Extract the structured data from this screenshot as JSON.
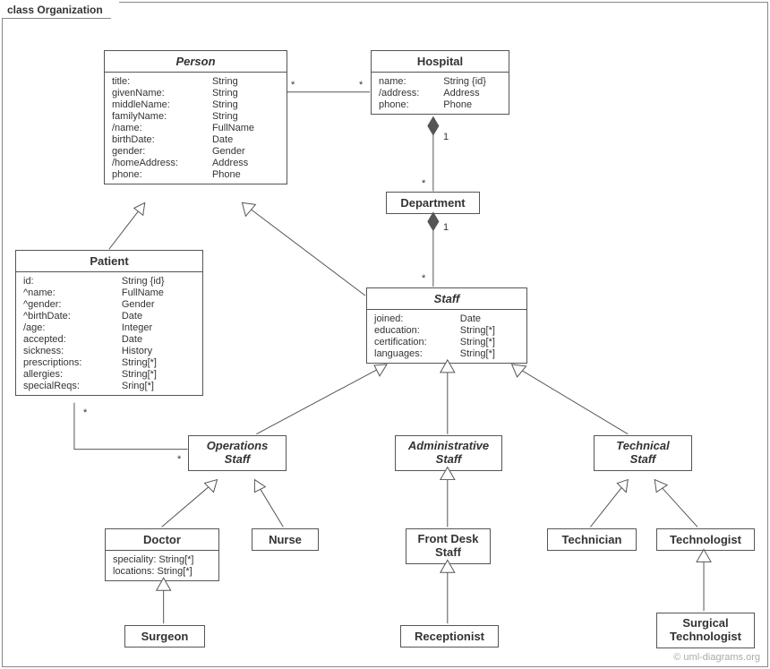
{
  "frame": {
    "title": "class Organization"
  },
  "watermark": "© uml-diagrams.org",
  "classes": {
    "person": {
      "name": "Person",
      "attrs": [
        {
          "n": "title:",
          "t": "String"
        },
        {
          "n": "givenName:",
          "t": "String"
        },
        {
          "n": "middleName:",
          "t": "String"
        },
        {
          "n": "familyName:",
          "t": "String"
        },
        {
          "n": "/name:",
          "t": "FullName"
        },
        {
          "n": "birthDate:",
          "t": "Date"
        },
        {
          "n": "gender:",
          "t": "Gender"
        },
        {
          "n": "/homeAddress:",
          "t": "Address"
        },
        {
          "n": "phone:",
          "t": "Phone"
        }
      ]
    },
    "hospital": {
      "name": "Hospital",
      "attrs": [
        {
          "n": "name:",
          "t": "String {id}"
        },
        {
          "n": "/address:",
          "t": "Address"
        },
        {
          "n": "phone:",
          "t": "Phone"
        }
      ]
    },
    "department": {
      "name": "Department"
    },
    "patient": {
      "name": "Patient",
      "attrs": [
        {
          "n": "id:",
          "t": "String {id}"
        },
        {
          "n": "^name:",
          "t": "FullName"
        },
        {
          "n": "^gender:",
          "t": "Gender"
        },
        {
          "n": "^birthDate:",
          "t": "Date"
        },
        {
          "n": "/age:",
          "t": "Integer"
        },
        {
          "n": "accepted:",
          "t": "Date"
        },
        {
          "n": "sickness:",
          "t": "History"
        },
        {
          "n": "prescriptions:",
          "t": "String[*]"
        },
        {
          "n": "allergies:",
          "t": "String[*]"
        },
        {
          "n": "specialReqs:",
          "t": "Sring[*]"
        }
      ]
    },
    "staff": {
      "name": "Staff",
      "attrs": [
        {
          "n": "joined:",
          "t": "Date"
        },
        {
          "n": "education:",
          "t": "String[*]"
        },
        {
          "n": "certification:",
          "t": "String[*]"
        },
        {
          "n": "languages:",
          "t": "String[*]"
        }
      ]
    },
    "opsStaff": {
      "name1": "Operations",
      "name2": "Staff"
    },
    "adminStaff": {
      "name1": "Administrative",
      "name2": "Staff"
    },
    "techStaff": {
      "name1": "Technical",
      "name2": "Staff"
    },
    "doctor": {
      "name": "Doctor",
      "attrs": [
        {
          "n": "speciality: String[*]"
        },
        {
          "n": "locations: String[*]"
        }
      ]
    },
    "nurse": {
      "name": "Nurse"
    },
    "frontDesk": {
      "name1": "Front Desk",
      "name2": "Staff"
    },
    "receptionist": {
      "name": "Receptionist"
    },
    "technician": {
      "name": "Technician"
    },
    "technologist": {
      "name": "Technologist"
    },
    "surgTech": {
      "name1": "Surgical",
      "name2": "Technologist"
    }
  },
  "mults": {
    "personHospL": "*",
    "personHospR": "*",
    "hospDept1": "1",
    "hospDeptStar": "*",
    "deptStaff1": "1",
    "deptStaffStar": "*",
    "patientOpsTop": "*",
    "patientOpsBottom": "*"
  }
}
